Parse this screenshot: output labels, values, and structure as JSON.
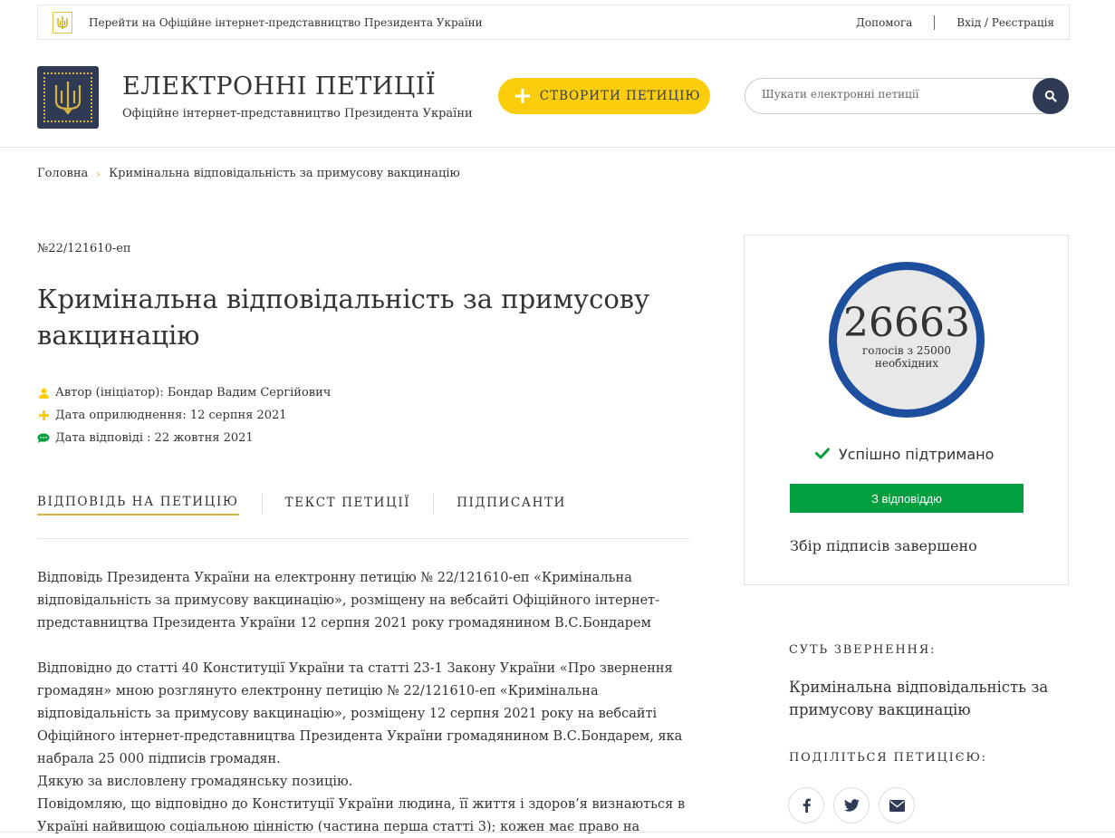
{
  "topbar": {
    "president_link": "Перейти на Офіційне інтернет-представництво Президента України",
    "help": "Допомога",
    "login": "Вхід / Реєстрація"
  },
  "header": {
    "title": "ЕЛЕКТРОННІ ПЕТИЦІЇ",
    "subtitle": "Офіційне інтернет-представництво Президента України",
    "create_button": "СТВОРИТИ ПЕТИЦІЮ",
    "search_placeholder": "Шукати електронні петиції"
  },
  "breadcrumb": {
    "home": "Головна",
    "current": "Кримінальна відповідальність за примусову вакцинацію"
  },
  "petition": {
    "number": "№22/121610-еп",
    "title": "Кримінальна відповідальність за примусову вакцинацію",
    "author": "Автор (ініціатор): Бондар Вадим Сергійович",
    "published": "Дата оприлюднення: 12 серпня 2021",
    "answered": "Дата відповіді : 22 жовтня 2021"
  },
  "tabs": [
    "ВІДПОВІДЬ НА ПЕТИЦІЮ",
    "ТЕКСТ ПЕТИЦІЇ",
    "ПІДПИСАНТИ"
  ],
  "answer": {
    "p1": "Відповідь Президента України на електронну петицію № 22/121610-еп «Кримінальна відповідальність за примусову вакцинацію», розміщену на вебсайті Офіційного інтернет-представництва Президента України 12 серпня 2021 року громадянином В.С.Бондарем",
    "p2": "Відповідно до статті 40 Конституції України та статті 23-1 Закону України «Про звернення громадян» мною розглянуто електронну петицію № 22/121610-еп «Кримінальна відповідальність за примусову вакцинацію», розміщену 12 серпня 2021 року на вебсайті Офіційного інтернет-представництва Президента України громадянином В.С.Бондарем, яка набрала 25 000 підписів громадян.",
    "p3": "Дякую за висловлену громадянську позицію.",
    "p4": "Повідомляю, що відповідно до Конституції України людина, її життя і здоров’я визнаються в Україні найвищою соціальною цінністю (частина перша статті 3); кожен має право на охорону"
  },
  "votes": {
    "count": "26663",
    "needed": "голосів з 25000 необхідних",
    "status": "Успішно підтримано",
    "answer_button": "З відповіддю",
    "collection": "Збір підписів завершено",
    "status_color": "#039e3d",
    "ring_color": "#1d4f9e"
  },
  "sidebar": {
    "essence_heading": "СУТЬ ЗВЕРНЕННЯ:",
    "essence_text": "Кримінальна відповідальність за примусову вакцинацію",
    "share_heading": "ПОДІЛІТЬСЯ ПЕТИЦІЄЮ:",
    "share_icons": [
      "facebook-icon",
      "twitter-icon",
      "email-icon"
    ]
  },
  "colors": {
    "accent_yellow": "#fccd0b",
    "navy": "#2f3a55",
    "gold": "#d6b441"
  }
}
